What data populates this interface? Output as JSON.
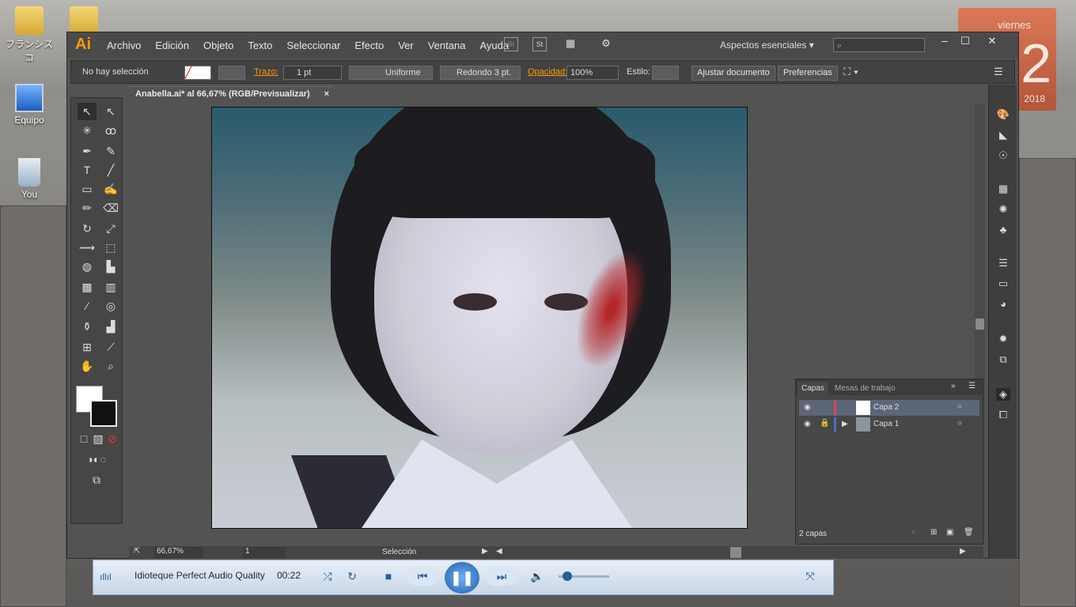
{
  "desktop": {
    "icons": [
      {
        "label": "フランシスコ"
      },
      {
        "label": "Equipo"
      },
      {
        "label": "You"
      }
    ],
    "calendar": {
      "day": "viernes",
      "number": "2",
      "year": "2018"
    }
  },
  "app": {
    "logo": "Ai",
    "menu": [
      "Archivo",
      "Edición",
      "Objeto",
      "Texto",
      "Seleccionar",
      "Efecto",
      "Ver",
      "Ventana",
      "Ayuda"
    ],
    "bridge": "Br",
    "stock": "St",
    "workspace": "Aspectos esenciales",
    "window_controls": {
      "minimize": "–",
      "maximize": "☐",
      "close": "✕"
    }
  },
  "control_bar": {
    "selection": "No hay selección",
    "stroke_label": "Trazo:",
    "stroke_value": "1 pt",
    "profile": "Uniforme",
    "brush": "Redondo 3 pt.",
    "opacity_label": "Opacidad:",
    "opacity_value": "100%",
    "style_label": "Estilo:",
    "fit_button": "Ajustar documento",
    "prefs_button": "Preferencias"
  },
  "document": {
    "tab_title": "Anabella.ai* al 66,67% (RGB/Previsualizar)",
    "close": "×"
  },
  "status": {
    "zoom": "66,67%",
    "page": "1",
    "tool": "Selección"
  },
  "layers_panel": {
    "tabs": [
      "Capas",
      "Mesas de trabajo"
    ],
    "layers": [
      {
        "name": "Capa 2",
        "color": "#e04646"
      },
      {
        "name": "Capa 1",
        "color": "#4a6fd1"
      }
    ],
    "count": "2 capas"
  },
  "player": {
    "title": "Idioteque Perfect Audio Quality",
    "time": "00:22",
    "volume": 0.1
  }
}
